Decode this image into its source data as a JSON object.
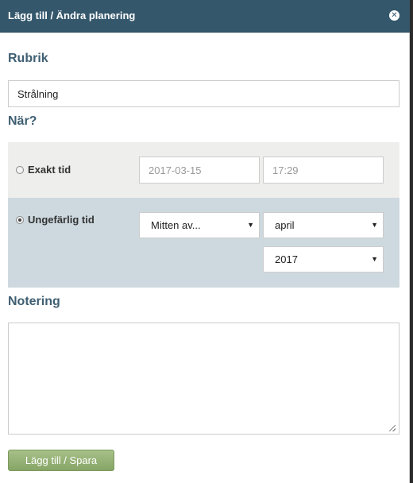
{
  "dialog": {
    "title": "Lägg till / Ändra planering",
    "close_icon": "close-icon"
  },
  "rubrik": {
    "heading": "Rubrik",
    "value": "Strålning"
  },
  "when": {
    "heading": "När?",
    "exact": {
      "label": "Exakt tid",
      "selected": false,
      "date": "2017-03-15",
      "time": "17:29"
    },
    "approx": {
      "label": "Ungefärlig tid",
      "selected": true,
      "qualifier": "Mitten av...",
      "month": "april",
      "year": "2017"
    }
  },
  "notes": {
    "heading": "Notering",
    "value": ""
  },
  "actions": {
    "submit_label": "Lägg till / Spara"
  },
  "colors": {
    "titlebar": "#34576c",
    "heading": "#3f5f73",
    "exact_panel": "#eeeeec",
    "approx_panel": "#cdd9df",
    "button": "#96b378"
  }
}
